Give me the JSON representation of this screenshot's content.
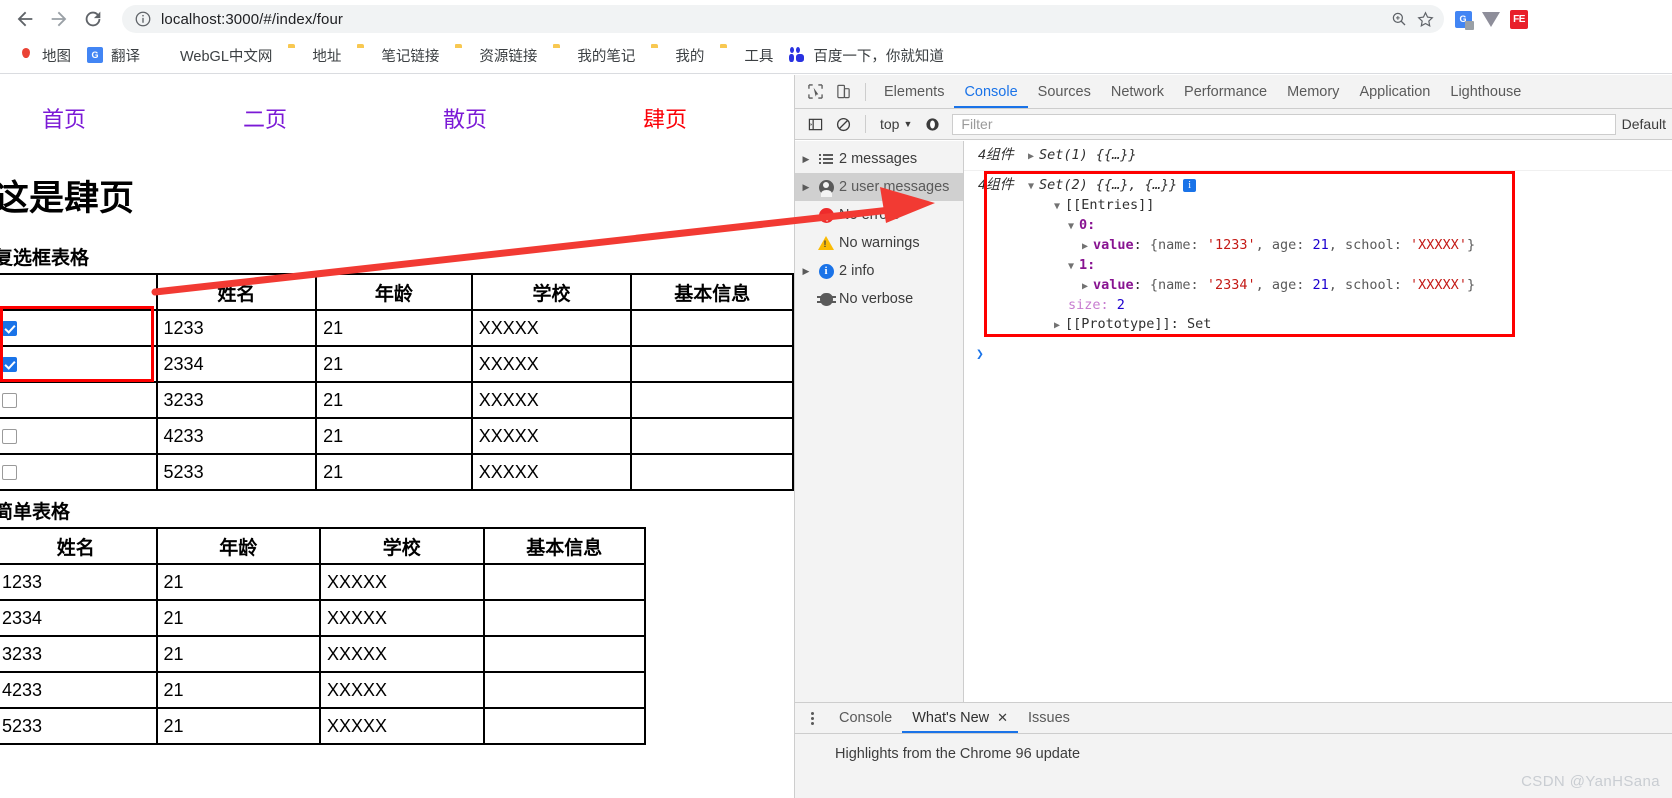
{
  "browser": {
    "back_label": "Back",
    "forward_label": "Forward",
    "reload_label": "Reload",
    "url": "localhost:3000/#/index/four",
    "site_info_icon": "info-circle-icon",
    "zoom_icon": "zoom-search-icon",
    "bookmark_icon": "star-icon",
    "extensions": [
      {
        "name": "google-translate-extension",
        "label": "G"
      },
      {
        "name": "v-extension",
        "label": ""
      },
      {
        "name": "fe-extension",
        "label": "FE"
      }
    ]
  },
  "bookmarks": [
    {
      "label": "地图",
      "icon": "google-maps-icon"
    },
    {
      "label": "翻译",
      "icon": "google-translate-icon"
    },
    {
      "label": "WebGL中文网",
      "icon": "webgl-site-icon"
    },
    {
      "label": "地址",
      "icon": "folder-icon"
    },
    {
      "label": "笔记链接",
      "icon": "folder-icon"
    },
    {
      "label": "资源链接",
      "icon": "folder-icon"
    },
    {
      "label": "我的笔记",
      "icon": "folder-icon"
    },
    {
      "label": "我的",
      "icon": "folder-icon"
    },
    {
      "label": "工具",
      "icon": "folder-icon"
    },
    {
      "label": "百度一下，你就知道",
      "icon": "baidu-icon"
    }
  ],
  "page": {
    "nav_links": [
      {
        "label": "首页",
        "active": false
      },
      {
        "label": "二页",
        "active": false
      },
      {
        "label": "散页",
        "active": false
      },
      {
        "label": "肆页",
        "active": true
      }
    ],
    "heading": "这是肆页",
    "checkbox_table": {
      "caption": "复选框表格",
      "headers": [
        "",
        "姓名",
        "年龄",
        "学校",
        "基本信息"
      ],
      "rows": [
        {
          "checked": true,
          "name": "1233",
          "age": "21",
          "school": "XXXXX",
          "info": ""
        },
        {
          "checked": true,
          "name": "2334",
          "age": "21",
          "school": "XXXXX",
          "info": ""
        },
        {
          "checked": false,
          "name": "3233",
          "age": "21",
          "school": "XXXXX",
          "info": ""
        },
        {
          "checked": false,
          "name": "4233",
          "age": "21",
          "school": "XXXXX",
          "info": ""
        },
        {
          "checked": false,
          "name": "5233",
          "age": "21",
          "school": "XXXXX",
          "info": ""
        }
      ]
    },
    "simple_table": {
      "caption": "简单表格",
      "headers": [
        "姓名",
        "年龄",
        "学校",
        "基本信息"
      ],
      "rows": [
        {
          "name": "1233",
          "age": "21",
          "school": "XXXXX",
          "info": ""
        },
        {
          "name": "2334",
          "age": "21",
          "school": "XXXXX",
          "info": ""
        },
        {
          "name": "3233",
          "age": "21",
          "school": "XXXXX",
          "info": ""
        },
        {
          "name": "4233",
          "age": "21",
          "school": "XXXXX",
          "info": ""
        },
        {
          "name": "5233",
          "age": "21",
          "school": "XXXXX",
          "info": ""
        }
      ]
    }
  },
  "devtools": {
    "inspect_icon": "inspect-cursor-icon",
    "device_icon": "device-toolbar-icon",
    "tabs": [
      {
        "label": "Elements",
        "active": false
      },
      {
        "label": "Console",
        "active": true
      },
      {
        "label": "Sources",
        "active": false
      },
      {
        "label": "Network",
        "active": false
      },
      {
        "label": "Performance",
        "active": false
      },
      {
        "label": "Memory",
        "active": false
      },
      {
        "label": "Application",
        "active": false
      },
      {
        "label": "Lighthouse",
        "active": false
      }
    ],
    "filterbar": {
      "sidebar_toggle_icon": "show-console-sidebar-icon",
      "clear_icon": "clear-console-icon",
      "context": "top",
      "context_caret": "▼",
      "eye_icon": "live-expression-icon",
      "filter_placeholder": "Filter",
      "levels_label": "Default"
    },
    "sidebar": [
      {
        "label": "2 messages",
        "icon": "messages-list-icon",
        "expandable": true,
        "selected": false
      },
      {
        "label": "2 user messages",
        "icon": "user-icon",
        "expandable": true,
        "selected": true
      },
      {
        "label": "No errors",
        "icon": "error-icon",
        "expandable": false,
        "selected": false
      },
      {
        "label": "No warnings",
        "icon": "warning-icon",
        "expandable": false,
        "selected": false
      },
      {
        "label": "2 info",
        "icon": "info-icon",
        "expandable": true,
        "selected": false
      },
      {
        "label": "No verbose",
        "icon": "verbose-bug-icon",
        "expandable": false,
        "selected": false
      }
    ],
    "console": {
      "row1": {
        "source": "4组件",
        "caret": "▶",
        "summary": "Set(1) {{…}}"
      },
      "row2": {
        "source": "4组件",
        "caret": "▼",
        "summary": "Set(2) {{…}, {…}}",
        "info_badge": "i",
        "entries_caret": "▼",
        "entries_label": "[[Entries]]",
        "items": [
          {
            "caret": "▼",
            "index": "0:",
            "value_caret": "▶",
            "value_key": "value",
            "value_text_prefix": "{name: ",
            "name": "'1233'",
            "mid": ", age: ",
            "age": "21",
            "mid2": ", school: ",
            "school": "'XXXXX'",
            "suffix": "}"
          },
          {
            "caret": "▼",
            "index": "1:",
            "value_caret": "▶",
            "value_key": "value",
            "value_text_prefix": "{name: ",
            "name": "'2334'",
            "mid": ", age: ",
            "age": "21",
            "mid2": ", school: ",
            "school": "'XXXXX'",
            "suffix": "}"
          }
        ],
        "size_key": "size:",
        "size_value": "2",
        "proto_caret": "▶",
        "proto_key": "[[Prototype]]:",
        "proto_value": "Set"
      },
      "prompt": "❯"
    },
    "drawer": {
      "tabs": [
        {
          "label": "Console",
          "active": false,
          "closeable": false
        },
        {
          "label": "What's New",
          "active": true,
          "closeable": true,
          "close_label": "✕"
        },
        {
          "label": "Issues",
          "active": false,
          "closeable": false
        }
      ],
      "content": "Highlights from the Chrome 96 update"
    }
  },
  "annotations": {
    "watermark": "CSDN @YanHSana",
    "highlight_color": "#fe0000"
  }
}
